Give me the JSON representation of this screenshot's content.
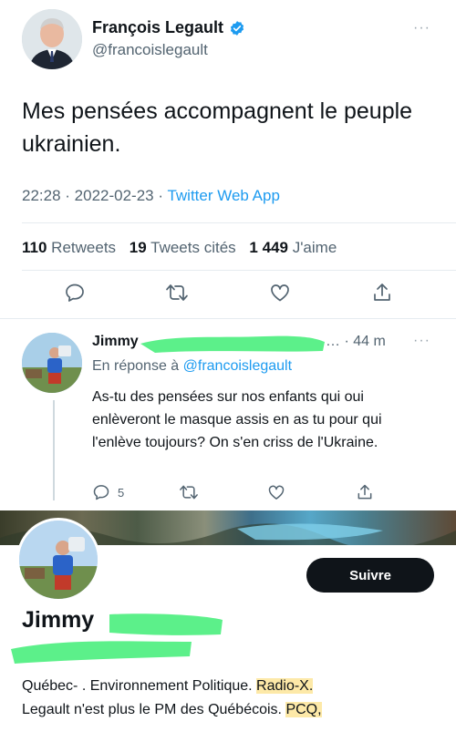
{
  "main_tweet": {
    "author_name": "François Legault",
    "author_handle": "@francoislegault",
    "more_label": "···",
    "text": "Mes pensées accompagnent le peuple ukrainien.",
    "time": "22:28",
    "separator": " · ",
    "date": "2022-02-23",
    "app": "Twitter Web App",
    "stats": {
      "retweets_count": "110",
      "retweets_label": "Retweets",
      "quotes_count": "19",
      "quotes_label": "Tweets cités",
      "likes_count": "1 449",
      "likes_label": "J'aime"
    },
    "icons": [
      "reply-icon",
      "retweet-icon",
      "like-icon",
      "share-icon"
    ]
  },
  "reply": {
    "author_name": "Jimmy",
    "time": "… · 44 m",
    "more_label": "···",
    "replying_prefix": "En réponse à ",
    "replying_to": "@francoislegault",
    "text": "As-tu des pensées sur nos enfants qui oui enlèveront le masque assis en as tu pour qui l'enlève toujours?  On s'en criss de l'Ukraine.",
    "reply_count": "5"
  },
  "profile": {
    "follow_label": "Suivre",
    "name": "Jimmy",
    "bio_plain": "Québec- . Environnement Politique. ",
    "bio_highlight1": "Radio-X.",
    "bio_line2_plain": "Legault n'est plus le PM des Québécois. ",
    "bio_highlight2": "PCQ,"
  },
  "colors": {
    "accent": "#1d9bf0",
    "text": "#0f1419",
    "secondary": "#536471",
    "redaction": "#5cf08a",
    "highlight": "#fde9a8"
  }
}
